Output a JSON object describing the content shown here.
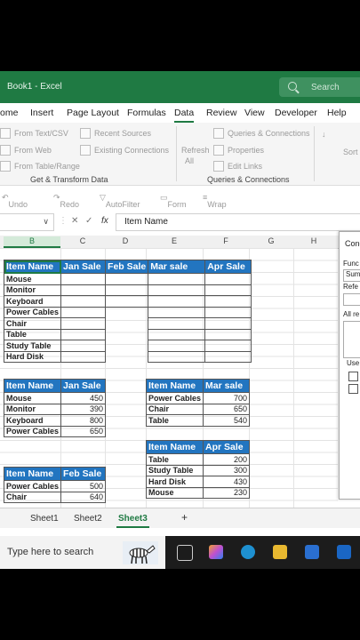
{
  "app": {
    "title": "Book1 - Excel",
    "search_placeholder": "Search"
  },
  "menu": [
    "ome",
    "Insert",
    "Page Layout",
    "Formulas",
    "Data",
    "Review",
    "View",
    "Developer",
    "Help"
  ],
  "ribbon": {
    "get_transform": {
      "from_text": "From Text/CSV",
      "from_web": "From Web",
      "from_table": "From Table/Range",
      "recent": "Recent Sources",
      "existing": "Existing Connections",
      "group": "Get & Transform Data"
    },
    "queries": {
      "refresh": "Refresh",
      "all": "All",
      "queries_conn": "Queries & Connections",
      "properties": "Properties",
      "edit_links": "Edit Links",
      "group": "Queries & Connections"
    },
    "sort": "Sort"
  },
  "quick_access": {
    "undo": "Undo",
    "redo": "Redo",
    "autofilter": "AutoFilter",
    "form": "Form",
    "wrap_text": "Wrap Text"
  },
  "formula_bar": {
    "fx": "fx",
    "value": "Item Name"
  },
  "columns": [
    "B",
    "C",
    "D",
    "E",
    "F",
    "G",
    "H"
  ],
  "sheet": {
    "main_headers": [
      "Item Name",
      "Jan Sale",
      "Feb Sale",
      "Mar sale",
      "Apr Sale"
    ],
    "main_items": [
      "Mouse",
      "Monitor",
      "Keyboard",
      "Power Cables",
      "Chair",
      "Table",
      "Study Table",
      "Hard Disk"
    ],
    "jan": {
      "headers": [
        "Item Name",
        "Jan Sale"
      ],
      "rows": [
        [
          "Mouse",
          "450"
        ],
        [
          "Monitor",
          "390"
        ],
        [
          "Keyboard",
          "800"
        ],
        [
          "Power Cables",
          "650"
        ]
      ]
    },
    "mar": {
      "headers": [
        "Item Name",
        "Mar sale"
      ],
      "rows": [
        [
          "Power Cables",
          "700"
        ],
        [
          "Chair",
          "650"
        ],
        [
          "Table",
          "540"
        ]
      ]
    },
    "apr": {
      "headers": [
        "Item Name",
        "Apr Sale"
      ],
      "rows": [
        [
          "Table",
          "200"
        ],
        [
          "Study Table",
          "300"
        ],
        [
          "Hard Disk",
          "430"
        ],
        [
          "Mouse",
          "230"
        ]
      ]
    },
    "feb": {
      "headers": [
        "Item Name",
        "Feb Sale"
      ],
      "rows": [
        [
          "Power Cables",
          "500"
        ],
        [
          "Chair",
          "640"
        ]
      ]
    }
  },
  "pane": {
    "title": "Conc",
    "function_label": "Func",
    "function_value": "Sum",
    "reference_label": "Refe",
    "all_refs": "All re",
    "use_labels": "Use"
  },
  "sheet_tabs": [
    "Sheet1",
    "Sheet2",
    "Sheet3",
    "+"
  ],
  "taskbar": {
    "search": "Type here to search"
  }
}
